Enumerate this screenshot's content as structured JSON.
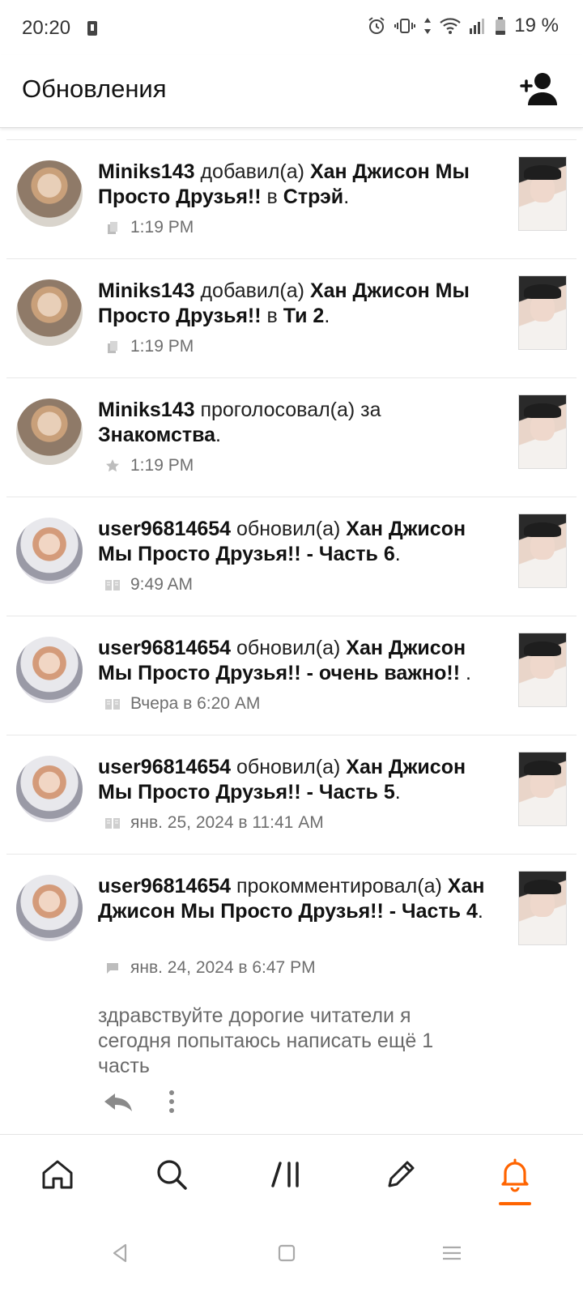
{
  "status": {
    "time": "20:20",
    "battery": "19 %"
  },
  "header": {
    "title": "Обновления"
  },
  "feed": [
    {
      "user": "Miniks143",
      "verb": " добавил(а) ",
      "story": "Хан Джисон Мы Просто Друзья!!",
      "suffix_prefix": " в ",
      "suffix": "Стрэй",
      "end": ".",
      "time": "1:19 PM",
      "meta_icon": "library-icon"
    },
    {
      "user": "Miniks143",
      "verb": " добавил(а) ",
      "story": "Хан Джисон Мы Просто Друзья!!",
      "suffix_prefix": " в ",
      "suffix": "Ти 2",
      "end": ".",
      "time": "1:19 PM",
      "meta_icon": "library-icon"
    },
    {
      "user": "Miniks143",
      "verb": " проголосовал(а) за ",
      "story": "Знакомства",
      "suffix_prefix": "",
      "suffix": "",
      "end": ".",
      "time": "1:19 PM",
      "meta_icon": "star-icon"
    },
    {
      "user": "user96814654",
      "verb": " обновил(а) ",
      "story": "Хан Джисон Мы Просто Друзья!! - Часть 6",
      "suffix_prefix": "",
      "suffix": "",
      "end": ".",
      "time": "9:49 AM",
      "meta_icon": "book-icon"
    },
    {
      "user": "user96814654",
      "verb": " обновил(а) ",
      "story": "Хан Джисон Мы Просто Друзья!! - очень важно!!",
      "suffix_prefix": "",
      "suffix": "",
      "end": " .",
      "time": "Вчера в 6:20 AM",
      "meta_icon": "book-icon"
    },
    {
      "user": "user96814654",
      "verb": " обновил(а) ",
      "story": "Хан Джисон Мы Просто Друзья!! - Часть 5",
      "suffix_prefix": "",
      "suffix": "",
      "end": ".",
      "time": "янв. 25, 2024 в 11:41 AM",
      "meta_icon": "book-icon"
    },
    {
      "user": "user96814654",
      "verb": " прокомментировал(а) ",
      "story": "Хан Джисон Мы Просто Друзья!! - Часть 4",
      "suffix_prefix": "",
      "suffix": "",
      "end": ".",
      "time": "янв. 24, 2024 в 6:47 PM",
      "meta_icon": "comment-icon",
      "comment": "здравствуйте дорогие читатели я сегодня попытаюсь написать ещё 1 часть"
    }
  ],
  "nav": {
    "items": [
      "home-icon",
      "search-icon",
      "library-icon",
      "write-icon",
      "notifications-icon"
    ],
    "active": "notifications-icon",
    "accent": "#ff6400"
  }
}
